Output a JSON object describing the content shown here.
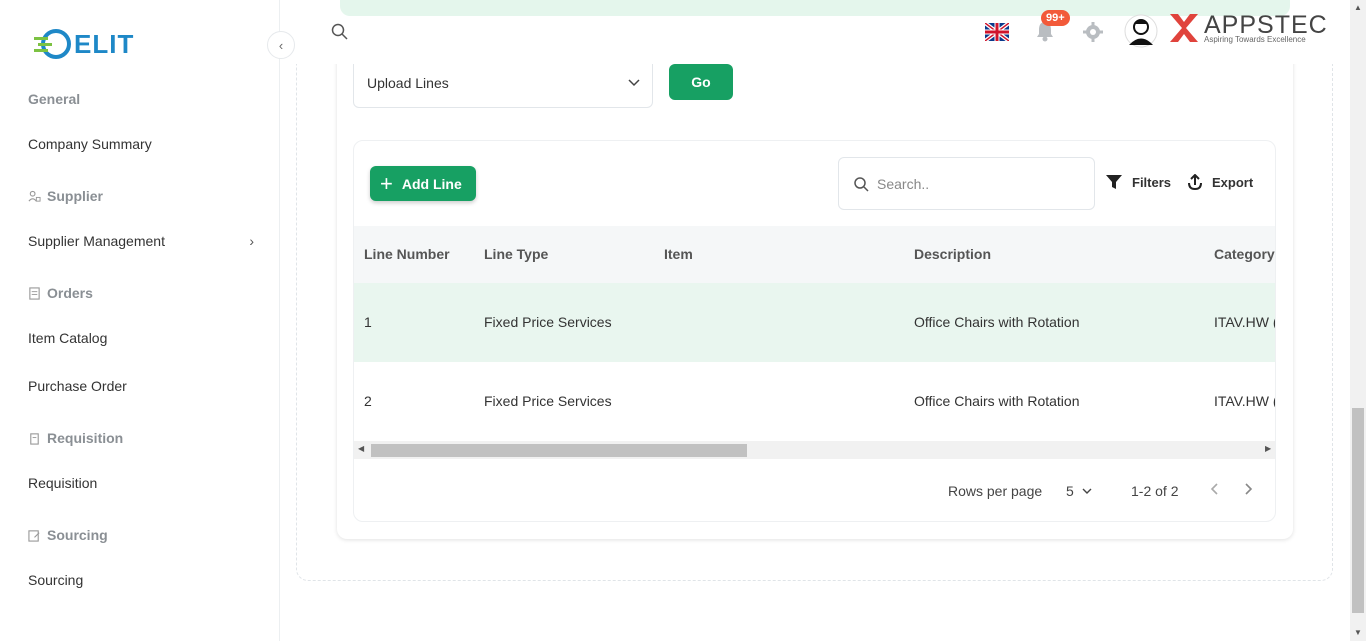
{
  "brand": {
    "app_logo": "ELIT",
    "company_name": "APPSTEC",
    "company_tagline": "Aspiring Towards Excellence"
  },
  "sidebar": {
    "sections": [
      {
        "label": "General",
        "icon": "none",
        "items": [
          {
            "label": "Company Summary",
            "has_chevron": false
          }
        ]
      },
      {
        "label": "Supplier",
        "icon": "supplier-icon",
        "items": [
          {
            "label": "Supplier Management",
            "has_chevron": true
          }
        ]
      },
      {
        "label": "Orders",
        "icon": "orders-icon",
        "items": [
          {
            "label": "Item Catalog"
          },
          {
            "label": "Purchase Order"
          }
        ]
      },
      {
        "label": "Requisition",
        "icon": "requisition-icon",
        "items": [
          {
            "label": "Requisition"
          }
        ]
      },
      {
        "label": "Sourcing",
        "icon": "sourcing-icon",
        "items": [
          {
            "label": "Sourcing"
          }
        ]
      }
    ]
  },
  "header": {
    "notification_count": "99+",
    "language_flag": "uk-flag-icon"
  },
  "actions": {
    "upload_select_value": "Upload Lines",
    "go_label": "Go"
  },
  "table_toolbar": {
    "add_line_label": "Add Line",
    "search_placeholder": "Search..",
    "filters_label": "Filters",
    "export_label": "Export"
  },
  "table": {
    "columns": [
      "Line Number",
      "Line Type",
      "Item",
      "Description",
      "Category"
    ],
    "rows": [
      {
        "line_number": "1",
        "line_type": "Fixed Price Services",
        "item": "",
        "description": "Office Chairs with Rotation",
        "category": "ITAV.HW ("
      },
      {
        "line_number": "2",
        "line_type": "Fixed Price Services",
        "item": "",
        "description": "Office Chairs with Rotation",
        "category": "ITAV.HW ("
      }
    ]
  },
  "pagination": {
    "rows_per_page_label": "Rows per page",
    "rows_per_page_value": "5",
    "range_text": "1-2 of 2"
  },
  "colors": {
    "primary_green": "#17a063",
    "row_highlight": "#e9f6ef",
    "logo_blue": "#1e88c7",
    "badge": "#f25a3a",
    "brand_red": "#e0433c"
  }
}
